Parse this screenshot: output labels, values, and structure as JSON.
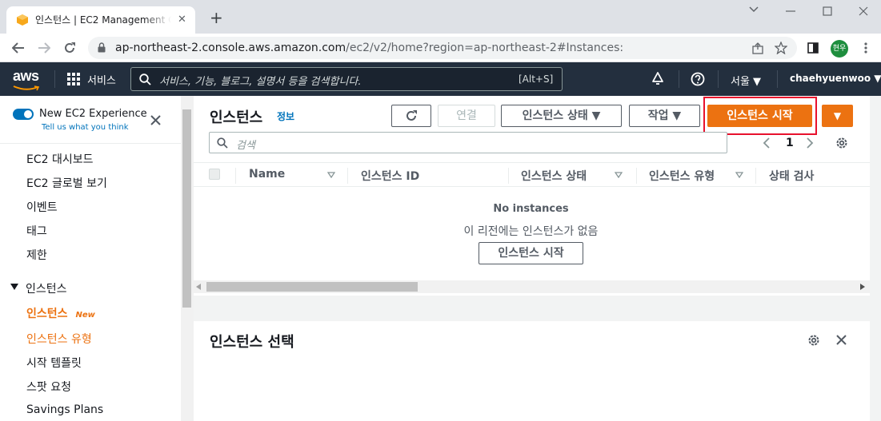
{
  "browser": {
    "tab_title": "인스턴스 | EC2 Management Console",
    "tab_close": "✕",
    "new_tab": "+",
    "url_host": "ap-northeast-2.console.aws.amazon.com",
    "url_path": "/ec2/v2/home?region=ap-northeast-2#Instances:",
    "profile_name": "현우"
  },
  "aws_header": {
    "logo": "aws",
    "services_label": "서비스",
    "search_placeholder": "서비스, 기능, 블로그, 설명서 등을 검색합니다.",
    "search_shortcut": "[Alt+S]",
    "region": "서울 ▼",
    "account": "chaehyuenwoo ▼"
  },
  "sidebar": {
    "toggle_label": "New EC2 Experience",
    "toggle_sub": "Tell us what you think",
    "items": [
      {
        "label": "EC2 대시보드"
      },
      {
        "label": "EC2 글로벌 보기"
      },
      {
        "label": "이벤트"
      },
      {
        "label": "태그"
      },
      {
        "label": "제한"
      }
    ],
    "section_title": "인스턴스",
    "section_items": [
      {
        "label": "인스턴스",
        "badge": "New"
      },
      {
        "label": "인스턴스 유형"
      },
      {
        "label": "시작 템플릿"
      },
      {
        "label": "스팟 요청"
      },
      {
        "label": "Savings Plans"
      }
    ]
  },
  "main": {
    "title": "인스턴스",
    "info_link": "정보",
    "connect_button": "연결",
    "state_button": "인스턴스 상태 ▼",
    "actions_button": "작업 ▼",
    "launch_button": "인스턴스 시작",
    "launch_dropdown": "▼",
    "search_placeholder": "검색",
    "page_number": "1",
    "columns": [
      "Name",
      "인스턴스 ID",
      "인스턴스 상태",
      "인스턴스 유형",
      "상태 검사"
    ],
    "empty_title": "No instances",
    "empty_sub": "이 리전에는 인스턴스가 없음",
    "empty_button": "인스턴스 시작",
    "drag_handle": "=",
    "detail_title": "인스턴스 선택"
  },
  "colors": {
    "aws_nav": "#232f3e",
    "accent_orange": "#ec7211",
    "highlight_red": "#e8112d",
    "link_blue": "#0073bb"
  }
}
